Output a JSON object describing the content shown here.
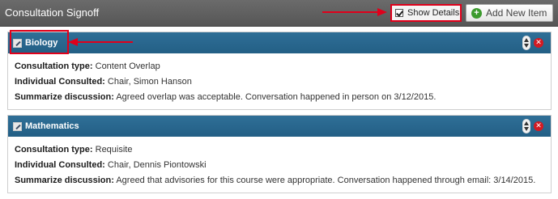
{
  "header": {
    "title": "Consultation Signoff",
    "show_details_label": "Show Details",
    "show_details_checked": true,
    "add_button_label": "Add New Item"
  },
  "items": [
    {
      "title": "Biology",
      "fields": [
        {
          "label": "Consultation type:",
          "value": "Content Overlap"
        },
        {
          "label": "Individual Consulted:",
          "value": "Chair, Simon Hanson"
        },
        {
          "label": "Summarize discussion:",
          "value": "Agreed overlap was acceptable. Conversation happened in person on 3/12/2015."
        }
      ]
    },
    {
      "title": "Mathematics",
      "fields": [
        {
          "label": "Consultation type:",
          "value": "Requisite"
        },
        {
          "label": "Individual Consulted:",
          "value": "Chair, Dennis Piontowski"
        },
        {
          "label": "Summarize discussion:",
          "value": "Agreed that advisories for this course were appropriate. Conversation happened through email: 3/14/2015."
        }
      ]
    }
  ],
  "icons": {
    "checkbox": "checkbox-checked-icon",
    "add": "plus-circle-icon",
    "edit": "edit-note-icon",
    "sort": "sort-handle-icon",
    "delete": "delete-circle-icon"
  },
  "colors": {
    "header_bg": "#5f5f5f",
    "card_header_bg": "#2a6a91",
    "annotation_red": "#e0001b",
    "add_icon_green": "#3c9b2e",
    "delete_red": "#d31a22"
  }
}
